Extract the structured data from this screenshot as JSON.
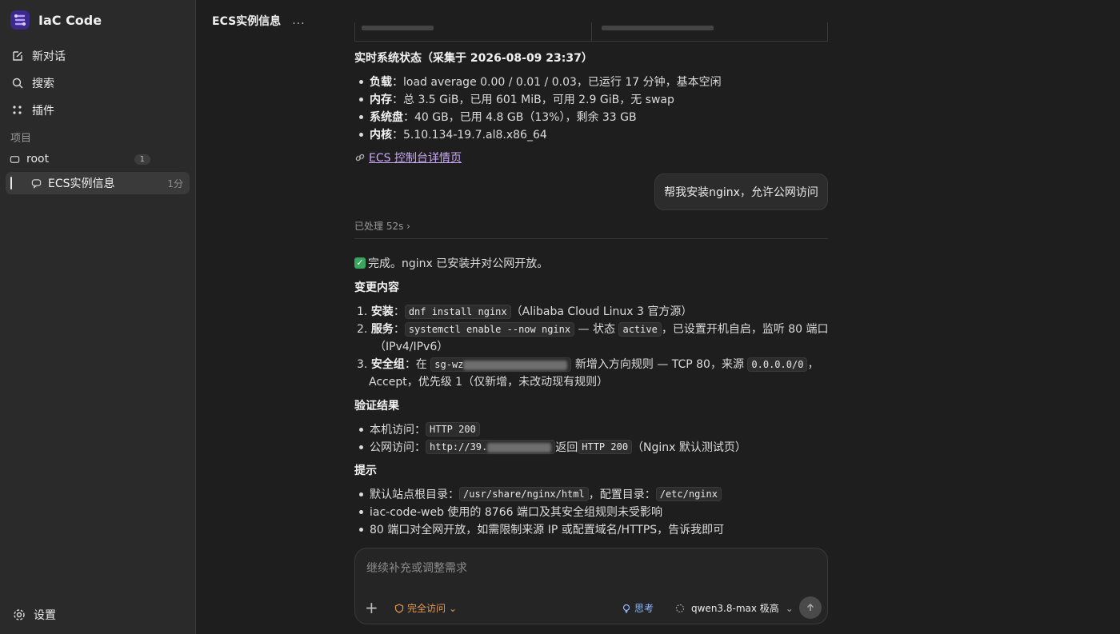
{
  "app": {
    "name": "IaC Code"
  },
  "sidebar": {
    "new_chat": "新对话",
    "search": "搜索",
    "plugins": "插件",
    "section_label": "项目",
    "project": {
      "name": "root",
      "count": "1"
    },
    "thread": {
      "title": "ECS实例信息",
      "time": "1分"
    },
    "settings": "设置"
  },
  "header": {
    "title": "ECS实例信息",
    "more": "..."
  },
  "message1": {
    "heading": "实时系统状态（采集于 2026-08-09 23:37）",
    "bullets": [
      {
        "label": "负载",
        "text": "：load average 0.00 / 0.01 / 0.03，已运行 17 分钟，基本空闲"
      },
      {
        "label": "内存",
        "text": "：总 3.5 GiB，已用 601 MiB，可用 2.9 GiB，无 swap"
      },
      {
        "label": "系统盘",
        "text": "：40 GB，已用 4.8 GB（13%），剩余 33 GB"
      },
      {
        "label": "内核",
        "text": "：5.10.134-19.7.al8.x86_64"
      }
    ],
    "link": "ECS 控制台详情页"
  },
  "user_message": "帮我安装nginx，允许公网访问",
  "processed": "已处理 52s",
  "message2": {
    "done": "完成。nginx 已安装并对公网开放。",
    "changes_heading": "变更内容",
    "item1": {
      "label": "安装",
      "sep": "：",
      "code": "dnf install nginx",
      "text": "（Alibaba Cloud Linux 3 官方源）"
    },
    "item2": {
      "label": "服务",
      "sep": "：",
      "code": "systemctl enable --now nginx",
      "mid": " — 状态 ",
      "code2": "active",
      "text": "，已设置开机自启，监听 80 端口",
      "line2": "（IPv4/IPv6）"
    },
    "item3": {
      "label": "安全组",
      "pre": "：在 ",
      "code": "sg-wz",
      "mid": " 新增入方向规则 — TCP 80，来源 ",
      "code2": "0.0.0.0/0",
      "tail": "，",
      "line2": "Accept，优先级 1（仅新增，未改动现有规则）"
    },
    "verify_heading": "验证结果",
    "verify1": {
      "pre": "本机访问：",
      "code": "HTTP 200"
    },
    "verify2": {
      "pre": "公网访问：",
      "code": "http://39.",
      "mid": " 返回 ",
      "code2": "HTTP 200",
      "tail": "（Nginx 默认测试页）"
    },
    "tips_heading": "提示",
    "tip1": {
      "pre": "默认站点根目录：",
      "code": "/usr/share/nginx/html",
      "mid": "，配置目录：",
      "code2": "/etc/nginx"
    },
    "tip2": "iac-code-web 使用的 8766 端口及其安全组规则未受影响",
    "tip3": "80 端口对全网开放，如需限制来源 IP 或配置域名/HTTPS，告诉我即可"
  },
  "composer": {
    "placeholder": "继续补充或调整需求",
    "access": "完全访问",
    "think": "思考",
    "model": "qwen3.8-max 极高"
  }
}
